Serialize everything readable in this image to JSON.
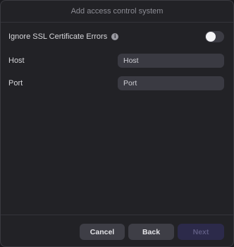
{
  "dialog": {
    "title": "Add access control system"
  },
  "ssl": {
    "label": "Ignore SSL Certificate Errors",
    "info_icon": "i",
    "toggle_on": false
  },
  "host": {
    "label": "Host",
    "value": "Host"
  },
  "port": {
    "label": "Port",
    "value": "Port"
  },
  "buttons": {
    "cancel": "Cancel",
    "back": "Back",
    "next": "Next"
  }
}
